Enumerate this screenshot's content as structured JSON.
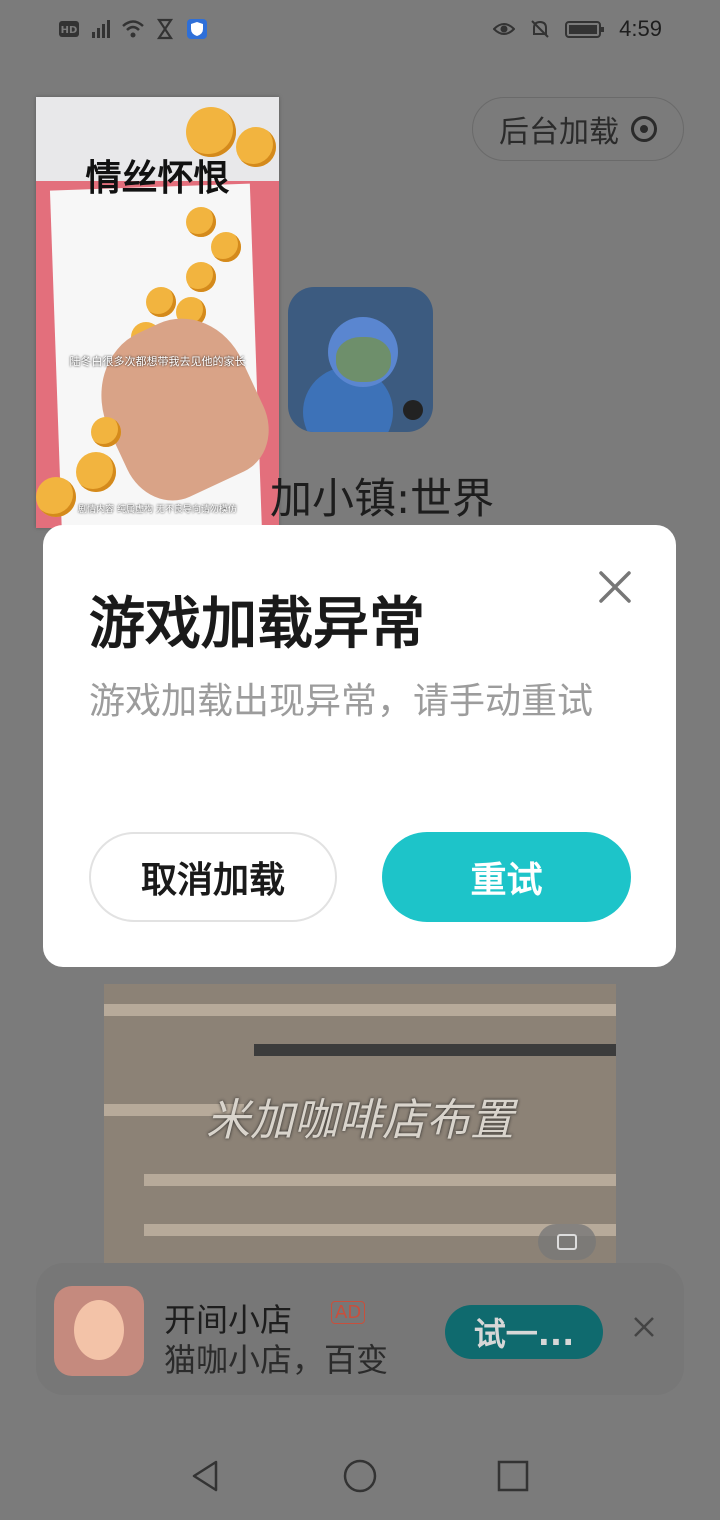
{
  "status_bar": {
    "time": "4:59",
    "icons_left": [
      "hd-icon",
      "4g-signal-icon",
      "wifi-icon",
      "hourglass-icon",
      "shield-app-icon"
    ],
    "icons_right": [
      "eye-icon",
      "mute-bell-icon",
      "battery-icon"
    ]
  },
  "background": {
    "background_load_button": "后台加载",
    "video": {
      "title": "情丝怀恨",
      "subtitle": "陆冬白很多次都想带我去见他的家长",
      "footer": "剧情内容 纯属虚构 无不良导向请勿模仿"
    },
    "app_name": "加小镇:世界",
    "game_screenshot_caption": "米加咖啡店布置"
  },
  "ad": {
    "title": "开间小店",
    "tag": "AD",
    "description": "猫咖小店，百变",
    "button": "试一..."
  },
  "dialog": {
    "title": "游戏加载异常",
    "message": "游戏加载出现异常，请手动重试",
    "cancel_label": "取消加载",
    "retry_label": "重试"
  },
  "colors": {
    "accent": "#1dc4c9",
    "overlay": "#7b7b7b",
    "dialog_bg": "#ffffff"
  }
}
